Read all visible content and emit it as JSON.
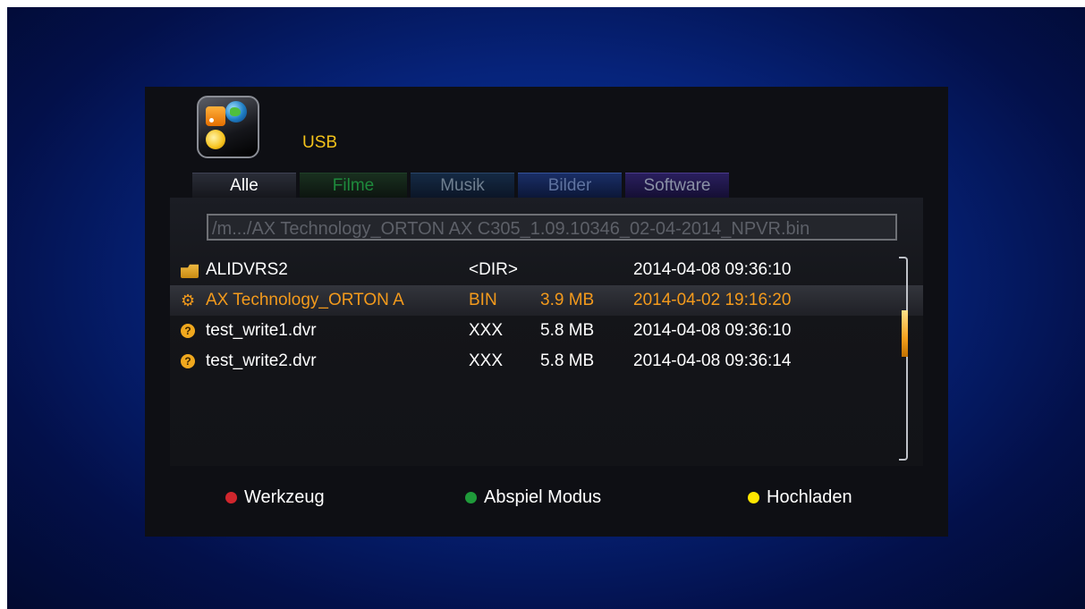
{
  "header": {
    "title": "USB"
  },
  "tabs": [
    {
      "label": "Alle"
    },
    {
      "label": "Filme"
    },
    {
      "label": "Musik"
    },
    {
      "label": "Bilder"
    },
    {
      "label": "Software"
    }
  ],
  "path": "/m.../AX Technology_ORTON AX C305_1.09.10346_02-04-2014_NPVR.bin",
  "files": [
    {
      "icon": "folder-icon",
      "name": "ALIDVRS2",
      "type": "<DIR>",
      "size": "",
      "date": "2014-04-08 09:36:10"
    },
    {
      "icon": "firmware-icon",
      "name": "AX Technology_ORTON A",
      "type": "BIN",
      "size": "3.9 MB",
      "date": "2014-04-02 19:16:20"
    },
    {
      "icon": "unknown-file-icon",
      "name": "test_write1.dvr",
      "type": "XXX",
      "size": "5.8 MB",
      "date": "2014-04-08 09:36:10"
    },
    {
      "icon": "unknown-file-icon",
      "name": "test_write2.dvr",
      "type": "XXX",
      "size": "5.8 MB",
      "date": "2014-04-08 09:36:14"
    }
  ],
  "footer": {
    "red_label": "Werkzeug",
    "green_label": "Abspiel Modus",
    "yellow_label": "Hochladen"
  },
  "colors": {
    "accent": "#f39a1c",
    "title": "#f3c21a",
    "red": "#d0262d",
    "green": "#1f9a3a",
    "yellow": "#ffe600"
  }
}
